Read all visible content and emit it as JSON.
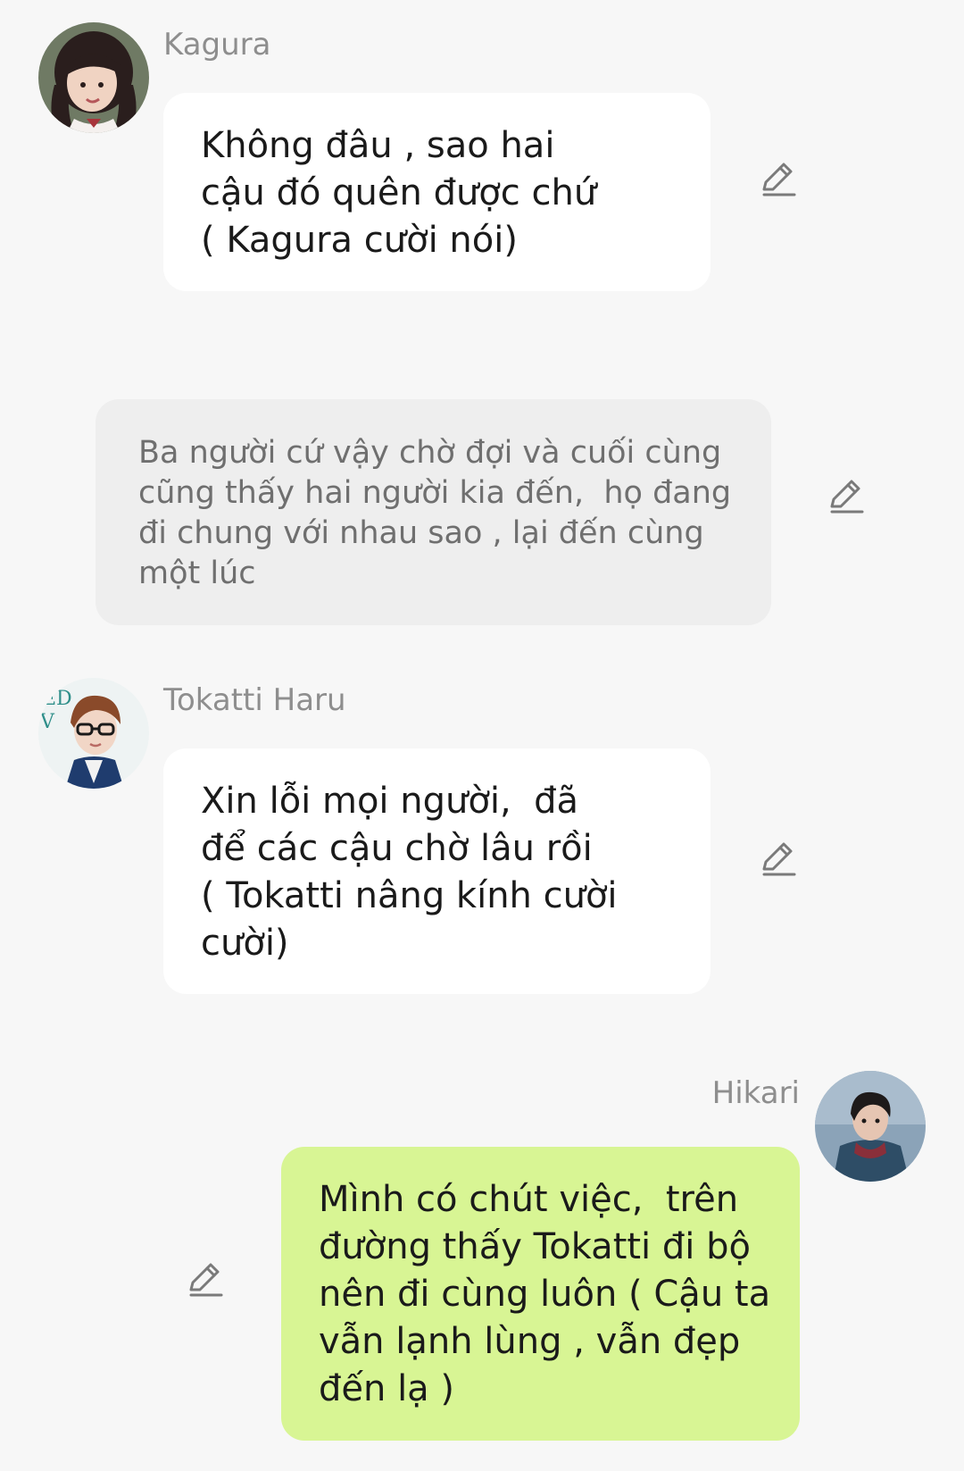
{
  "messages": [
    {
      "sender": "Kagura",
      "avatar_icon": "girl-avatar-icon",
      "lines": [
        "Không đâu , sao hai",
        "cậu đó quên được chứ",
        "( Kagura cười nói)"
      ]
    },
    {
      "sender": "Tokatti Haru",
      "avatar_icon": "boy-with-glasses-avatar-icon",
      "lines": [
        "Xin lỗi mọi người,  đã",
        "để các cậu chờ lâu rồi",
        "( Tokatti nâng kính cười",
        "cười)"
      ]
    },
    {
      "sender": "Hikari",
      "avatar_icon": "boy-in-jacket-avatar-icon",
      "lines": [
        "Mình có chút việc,  trên",
        "đường thấy Tokatti đi bộ",
        "nên đi cùng luôn ( Cậu ta",
        "vẫn lạnh lùng , vẫn đẹp",
        "đến lạ )"
      ]
    }
  ],
  "narration": {
    "lines": [
      "Ba người cứ vậy chờ đợi và cuối cùng",
      "cũng thấy hai người kia đến,  họ đang",
      "đi chung với nhau sao , lại đến cùng",
      "một lúc"
    ]
  },
  "icons": {
    "edit": "pencil-edit-icon"
  },
  "colors": {
    "background": "#f7f7f7",
    "incoming_bubble": "#ffffff",
    "outgoing_bubble": "#d8f594",
    "narration_bubble": "#eeeeee",
    "sender_name": "#8e8e8e",
    "edit_icon": "#7a7a7a"
  }
}
